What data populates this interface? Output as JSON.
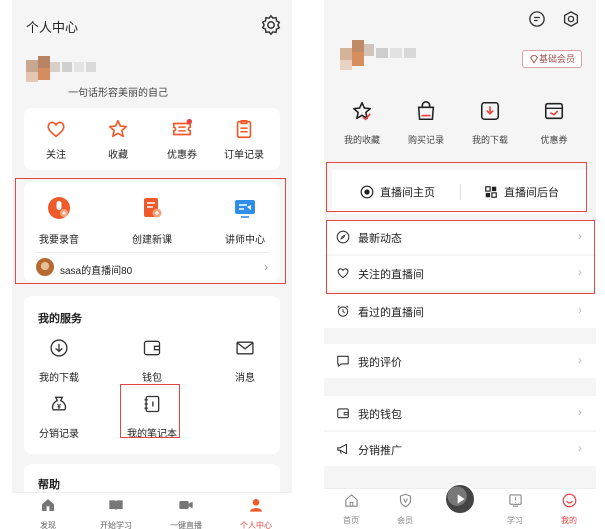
{
  "left": {
    "header": {
      "title": "个人中心",
      "signature": "一句话形容美丽的自己"
    },
    "quick": [
      {
        "label": "关注",
        "icon": "heart-icon"
      },
      {
        "label": "收藏",
        "icon": "star-icon"
      },
      {
        "label": "优惠券",
        "icon": "coupon-icon"
      },
      {
        "label": "订单记录",
        "icon": "order-icon"
      }
    ],
    "create": [
      {
        "label": "我要录音",
        "icon": "record-icon"
      },
      {
        "label": "创建新课",
        "icon": "new-course-icon"
      },
      {
        "label": "讲师中心",
        "icon": "teacher-center-icon"
      }
    ],
    "live_room": {
      "name": "sasa的直播间80"
    },
    "services": {
      "title": "我的服务",
      "items": [
        {
          "label": "我的下载",
          "icon": "download-icon"
        },
        {
          "label": "钱包",
          "icon": "wallet-icon"
        },
        {
          "label": "消息",
          "icon": "mail-icon"
        },
        {
          "label": "分销记录",
          "icon": "money-bag-icon"
        },
        {
          "label": "我的笔记本",
          "icon": "notebook-icon"
        }
      ]
    },
    "help": {
      "title": "帮助"
    },
    "tabbar": [
      {
        "label": "发现",
        "icon": "home-icon"
      },
      {
        "label": "开始学习",
        "icon": "book-icon"
      },
      {
        "label": "一键直播",
        "icon": "video-icon"
      },
      {
        "label": "个人中心",
        "icon": "profile-icon"
      }
    ]
  },
  "right": {
    "vip_label": "基础会员",
    "quick": [
      {
        "label": "我的收藏",
        "icon": "star-check-icon"
      },
      {
        "label": "购买记录",
        "icon": "bag-icon"
      },
      {
        "label": "我的下载",
        "icon": "download-box-icon"
      },
      {
        "label": "优惠券",
        "icon": "coupon-icon"
      }
    ],
    "live": {
      "home": "直播间主页",
      "backend": "直播间后台"
    },
    "menu": [
      {
        "label": "最新动态",
        "icon": "compass-icon"
      },
      {
        "label": "关注的直播间",
        "icon": "heart-tag-icon"
      },
      {
        "label": "看过的直播间",
        "icon": "alarm-clock-icon"
      },
      {
        "label": "我的评价",
        "icon": "comment-icon"
      },
      {
        "label": "我的钱包",
        "icon": "wallet-icon"
      },
      {
        "label": "分销推广",
        "icon": "megaphone-icon"
      }
    ],
    "tabbar": [
      {
        "label": "首页",
        "icon": "home-icon"
      },
      {
        "label": "会员",
        "icon": "shield-v-icon"
      },
      {
        "label": "学习",
        "icon": "study-icon"
      },
      {
        "label": "我的",
        "icon": "smile-icon"
      }
    ]
  },
  "colors": {
    "accent": "#e94444",
    "icon_orange": "#f05a2a",
    "icon_blue": "#2f8ee8",
    "highlight_box": "#e94444"
  }
}
